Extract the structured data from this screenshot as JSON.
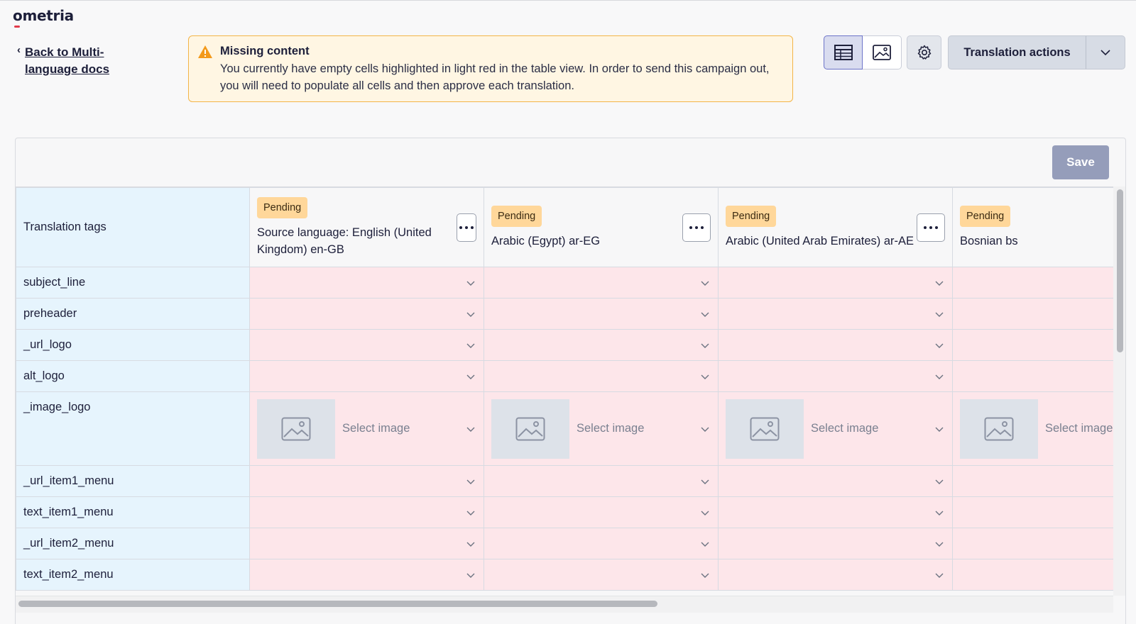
{
  "app": {
    "logo_text": "ometria"
  },
  "nav": {
    "back_label": "Back to Multi-language docs"
  },
  "alert": {
    "title": "Missing content",
    "message": "You currently have empty cells highlighted in light red in the table view. In order to send this campaign out, you will need to populate all cells and then approve each translation."
  },
  "toolbar": {
    "table_view_icon": "table-icon",
    "preview_view_icon": "image-icon",
    "settings_icon": "gear-icon",
    "translation_actions_label": "Translation actions",
    "save_label": "Save"
  },
  "colors": {
    "accent": "#6d74c9",
    "warning_border": "#f3b548",
    "warning_bg": "#fff6e3",
    "empty_cell": "#fde6ea",
    "tag_column": "#e6f4fd",
    "pending_badge": "#ffd79a",
    "save_button": "#959dba"
  },
  "table": {
    "tag_header": "Translation tags",
    "select_image_label": "Select image",
    "languages": [
      {
        "status": "Pending",
        "name": "Source language: English (United Kingdom) en-GB"
      },
      {
        "status": "Pending",
        "name": "Arabic (Egypt) ar-EG"
      },
      {
        "status": "Pending",
        "name": "Arabic (United Arab Emirates) ar-AE"
      },
      {
        "status": "Pending",
        "name": "Bosnian bs"
      }
    ],
    "tags": [
      {
        "name": "subject_line",
        "kind": "text"
      },
      {
        "name": "preheader",
        "kind": "text"
      },
      {
        "name": "_url_logo",
        "kind": "text"
      },
      {
        "name": "alt_logo",
        "kind": "text"
      },
      {
        "name": "_image_logo",
        "kind": "image"
      },
      {
        "name": "_url_item1_menu",
        "kind": "text"
      },
      {
        "name": "text_item1_menu",
        "kind": "text"
      },
      {
        "name": "_url_item2_menu",
        "kind": "text"
      },
      {
        "name": "text_item2_menu",
        "kind": "text"
      }
    ]
  }
}
